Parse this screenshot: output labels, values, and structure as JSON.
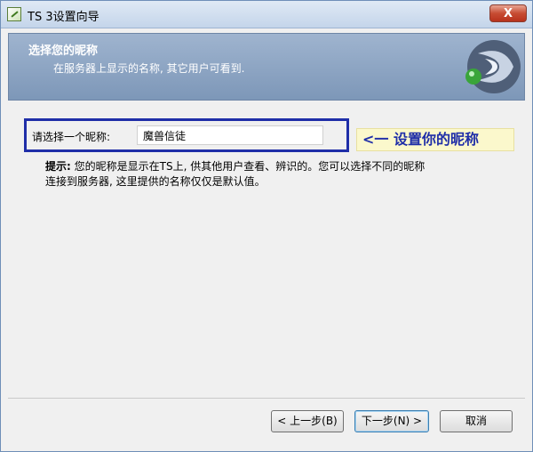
{
  "window": {
    "title": "TS 3设置向导",
    "close_label": "X"
  },
  "header": {
    "title": "选择您的昵称",
    "subtitle": "在服务器上显示的名称, 其它用户可看到."
  },
  "form": {
    "nickname_label": "请选择一个昵称:",
    "nickname_value": "魔兽信徒"
  },
  "annotation": {
    "text": "<一 设置你的昵称"
  },
  "tip": {
    "label": "提示:",
    "line1": "您的昵称是显示在TS上, 供其他用户查看、辨识的。您可以选择不同的昵称",
    "line2": "连接到服务器, 这里提供的名称仅仅是默认值。"
  },
  "buttons": {
    "back": "< 上一步(B)",
    "next": "下一步(N) >",
    "cancel": "取消"
  },
  "colors": {
    "header_bg": "#8ea6c6",
    "highlight_border": "#1f2ea8",
    "annotation_bg": "#fbf8cc"
  }
}
